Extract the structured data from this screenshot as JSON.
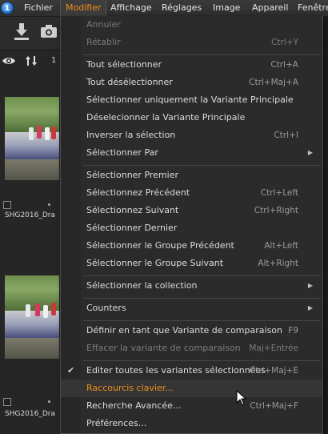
{
  "app": {
    "logo_text": "1"
  },
  "menubar": {
    "items": [
      {
        "label": "Fichier",
        "active": false
      },
      {
        "label": "Modifier",
        "active": true
      },
      {
        "label": "Affichage",
        "active": false
      },
      {
        "label": "Réglages",
        "active": false
      },
      {
        "label": "Image",
        "active": false
      },
      {
        "label": "Appareil",
        "active": false
      },
      {
        "label": "Fenêtre",
        "active": false
      }
    ]
  },
  "toolbar": {
    "count_label": "1"
  },
  "thumbnails": [
    {
      "label": "SHG2016_Dra"
    },
    {
      "label": "SHG2016_Dra"
    }
  ],
  "menu": {
    "accent_color": "#f08c1a",
    "items": [
      {
        "label": "Annuler",
        "shortcut": "",
        "disabled": true
      },
      {
        "label": "Rétablir",
        "shortcut": "Ctrl+Y",
        "disabled": true
      },
      {
        "label": "Tout sélectionner",
        "shortcut": "Ctrl+A"
      },
      {
        "label": "Tout désélectionner",
        "shortcut": "Ctrl+Maj+A"
      },
      {
        "label": "Sélectionner uniquement la Variante Principale",
        "shortcut": ""
      },
      {
        "label": "Déselecionner la Variante Principale",
        "shortcut": ""
      },
      {
        "label": "Inverser la sélection",
        "shortcut": "Ctrl+I"
      },
      {
        "label": "Sélectionner Par",
        "shortcut": "",
        "submenu": true
      },
      {
        "label": "Sélectionner Premier",
        "shortcut": ""
      },
      {
        "label": "Sélectionnez Précédent",
        "shortcut": "Ctrl+Left"
      },
      {
        "label": "Sélectionnez Suivant",
        "shortcut": "Ctrl+Right"
      },
      {
        "label": "Sélectionner Dernier",
        "shortcut": ""
      },
      {
        "label": "Sélectionner le Groupe Précédent",
        "shortcut": "Alt+Left"
      },
      {
        "label": "Sélectionner le Groupe Suivant",
        "shortcut": "Alt+Right"
      },
      {
        "label": "Sélectionner la collection",
        "shortcut": "",
        "submenu": true
      },
      {
        "label": "Counters",
        "shortcut": "",
        "submenu": true
      },
      {
        "label": "Définir en tant que Variante de comparaison",
        "shortcut": "F9"
      },
      {
        "label": "Effacer la variante de comparaison",
        "shortcut": "Maj+Entrée",
        "disabled": true
      },
      {
        "label": "Editer toutes les variantes sélectionnées",
        "shortcut": "Ctrl+Maj+E",
        "checked": true
      },
      {
        "label": "Raccourcis clavier...",
        "shortcut": "",
        "highlighted": true
      },
      {
        "label": "Recherche Avancée...",
        "shortcut": "Ctrl+Maj+F"
      },
      {
        "label": "Préférences...",
        "shortcut": ""
      }
    ]
  }
}
